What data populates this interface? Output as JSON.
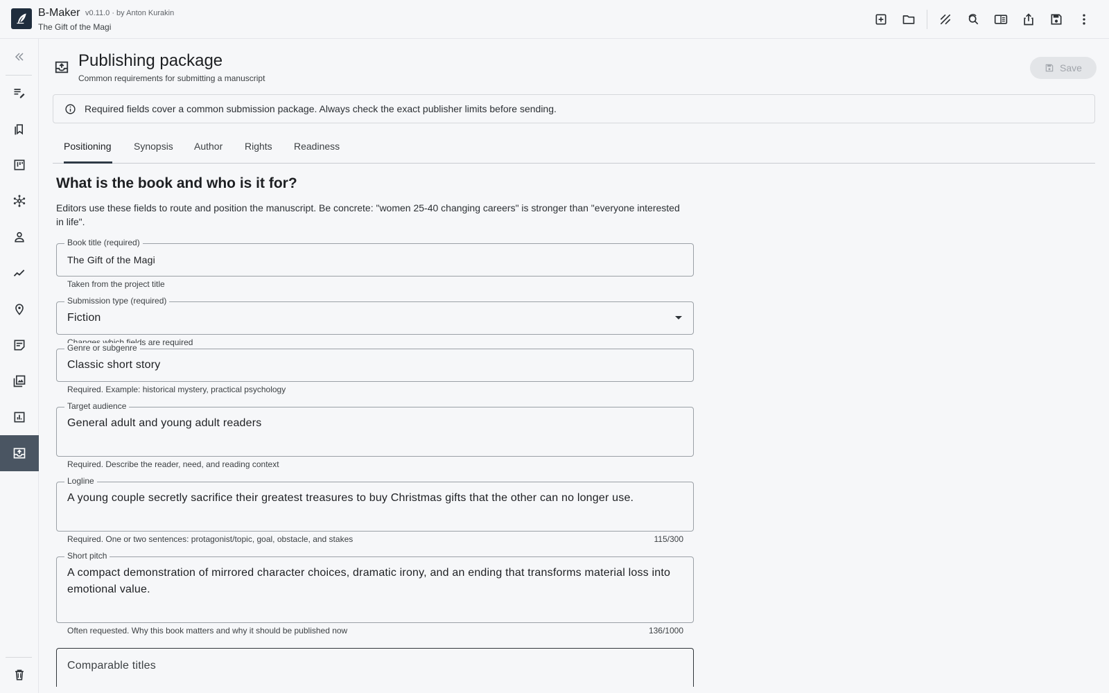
{
  "header": {
    "app_name": "B-Maker",
    "version_author": "v0.11.0 · by Anton Kurakin",
    "project_title": "The Gift of the Magi"
  },
  "toolbar": {
    "icons": [
      "add-box-icon",
      "folder-icon",
      "texture-icon",
      "find-replace-icon",
      "chrome-reader-mode-icon",
      "ios-share-icon",
      "save-icon",
      "more-vert-icon"
    ]
  },
  "sidebar": {
    "items": [
      "collapse-icon",
      "edit-note-icon",
      "bookmarks-icon",
      "kanban-board-icon",
      "hub-icon",
      "person-icon",
      "timeline-icon",
      "place-icon",
      "sticky-note-icon",
      "photo-library-icon",
      "analytics-icon",
      "publish-icon",
      "delete-icon"
    ],
    "active": "publish-icon"
  },
  "page": {
    "title": "Publishing package",
    "subtitle": "Common requirements for submitting a manuscript",
    "save_label": "Save"
  },
  "banner": {
    "text": "Required fields cover a common submission package. Always check the exact publisher limits before sending."
  },
  "tabs": [
    {
      "label": "Positioning",
      "active": true
    },
    {
      "label": "Synopsis",
      "active": false
    },
    {
      "label": "Author",
      "active": false
    },
    {
      "label": "Rights",
      "active": false
    },
    {
      "label": "Readiness",
      "active": false
    }
  ],
  "section": {
    "title": "What is the book and who is it for?",
    "description": "Editors use these fields to route and position the manuscript. Be concrete: \"women 25-40 changing careers\" is stronger than \"everyone interested in life\"."
  },
  "fields": {
    "book_title": {
      "label": "Book title (required)",
      "value": "The Gift of the Magi",
      "helper": "Taken from the project title"
    },
    "submission_type": {
      "label": "Submission type (required)",
      "value": "Fiction",
      "helper": "Changes which fields are required"
    },
    "genre": {
      "label": "Genre or subgenre",
      "value": "Classic short story",
      "helper": "Required. Example: historical mystery, practical psychology"
    },
    "audience": {
      "label": "Target audience",
      "value": "General adult and young adult readers",
      "helper": "Required. Describe the reader, need, and reading context"
    },
    "logline": {
      "label": "Logline",
      "value": "A young couple secretly sacrifice their greatest treasures to buy Christmas gifts that the other can no longer use.",
      "helper": "Required. One or two sentences: protagonist/topic, goal, obstacle, and stakes",
      "count": "115/300"
    },
    "pitch": {
      "label": "Short pitch",
      "value": "A compact demonstration of mirrored character choices, dramatic irony, and an ending that transforms material loss into emotional value.",
      "helper": "Often requested. Why this book matters and why it should be published now",
      "count": "136/1000"
    },
    "comparables": {
      "placeholder": "Comparable titles"
    }
  }
}
